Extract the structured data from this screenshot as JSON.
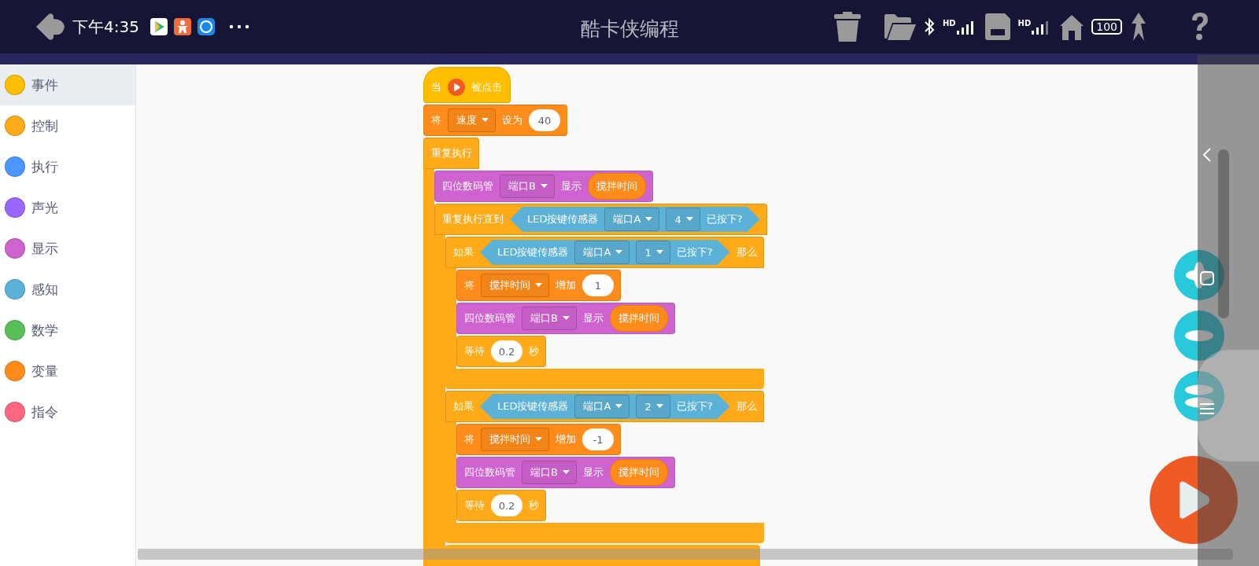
{
  "status_bar": {
    "time": "下午4:35",
    "signal_labels": [
      "HD",
      "HD"
    ],
    "battery": "100"
  },
  "app_bar": {
    "title": "酷卡侠编程"
  },
  "categories": [
    {
      "label": "事件",
      "color": "#ffbf00",
      "selected": true
    },
    {
      "label": "控制",
      "color": "#ffab19",
      "selected": false
    },
    {
      "label": "执行",
      "color": "#4c97ff",
      "selected": false
    },
    {
      "label": "声光",
      "color": "#9966ff",
      "selected": false
    },
    {
      "label": "显示",
      "color": "#cf63cf",
      "selected": false
    },
    {
      "label": "感知",
      "color": "#5cb1d6",
      "selected": false
    },
    {
      "label": "数学",
      "color": "#59c059",
      "selected": false
    },
    {
      "label": "变量",
      "color": "#ff8c1a",
      "selected": false
    },
    {
      "label": "指令",
      "color": "#ff6680",
      "selected": false
    }
  ],
  "script": [
    {
      "kind": "hat",
      "color": "#ffbf00",
      "parts": [
        {
          "kind": "text",
          "text": "当"
        },
        {
          "kind": "flag"
        },
        {
          "kind": "text",
          "text": "被点击"
        }
      ]
    },
    {
      "kind": "stack",
      "color": "#ff8c1a",
      "parts": [
        {
          "kind": "text",
          "text": "将"
        },
        {
          "kind": "dropdown",
          "text": "速度"
        },
        {
          "kind": "text",
          "text": "设为"
        },
        {
          "kind": "number",
          "text": "40"
        }
      ]
    },
    {
      "kind": "c",
      "color": "#ffab19",
      "footer": false,
      "parts": [
        {
          "kind": "text",
          "text": "重复执行"
        }
      ],
      "children": [
        {
          "kind": "stack",
          "color": "#cf63cf",
          "parts": [
            {
              "kind": "text",
              "text": "四位数码管"
            },
            {
              "kind": "dropdown",
              "text": "端口B"
            },
            {
              "kind": "text",
              "text": "显示"
            },
            {
              "kind": "reporter",
              "color": "#ff8c1a",
              "text": "搅拌时间"
            }
          ]
        },
        {
          "kind": "c",
          "color": "#ffab19",
          "footer": false,
          "parts": [
            {
              "kind": "text",
              "text": "重复执行直到"
            },
            {
              "kind": "boolean",
              "color": "#5cb1d6",
              "parts": [
                {
                  "kind": "text",
                  "text": "LED按键传感器"
                },
                {
                  "kind": "dropdown",
                  "text": "端口A"
                },
                {
                  "kind": "dropdown",
                  "text": "4"
                },
                {
                  "kind": "text",
                  "text": "已按下?"
                }
              ]
            }
          ],
          "children": [
            {
              "kind": "c",
              "color": "#ffab19",
              "footer": true,
              "parts": [
                {
                  "kind": "text",
                  "text": "如果"
                },
                {
                  "kind": "boolean",
                  "color": "#5cb1d6",
                  "parts": [
                    {
                      "kind": "text",
                      "text": "LED按键传感器"
                    },
                    {
                      "kind": "dropdown",
                      "text": "端口A"
                    },
                    {
                      "kind": "dropdown",
                      "text": "1"
                    },
                    {
                      "kind": "text",
                      "text": "已按下?"
                    }
                  ]
                },
                {
                  "kind": "text",
                  "text": "那么"
                }
              ],
              "children": [
                {
                  "kind": "stack",
                  "color": "#ff8c1a",
                  "parts": [
                    {
                      "kind": "text",
                      "text": "将"
                    },
                    {
                      "kind": "dropdown",
                      "text": "搅拌时间"
                    },
                    {
                      "kind": "text",
                      "text": "增加"
                    },
                    {
                      "kind": "number",
                      "text": "1"
                    }
                  ]
                },
                {
                  "kind": "stack",
                  "color": "#cf63cf",
                  "parts": [
                    {
                      "kind": "text",
                      "text": "四位数码管"
                    },
                    {
                      "kind": "dropdown",
                      "text": "端口B"
                    },
                    {
                      "kind": "text",
                      "text": "显示"
                    },
                    {
                      "kind": "reporter",
                      "color": "#ff8c1a",
                      "text": "搅拌时间"
                    }
                  ]
                },
                {
                  "kind": "stack",
                  "color": "#ffab19",
                  "parts": [
                    {
                      "kind": "text",
                      "text": "等待"
                    },
                    {
                      "kind": "number",
                      "text": "0.2"
                    },
                    {
                      "kind": "text",
                      "text": "秒"
                    }
                  ]
                }
              ]
            },
            {
              "kind": "c",
              "color": "#ffab19",
              "footer": true,
              "parts": [
                {
                  "kind": "text",
                  "text": "如果"
                },
                {
                  "kind": "boolean",
                  "color": "#5cb1d6",
                  "parts": [
                    {
                      "kind": "text",
                      "text": "LED按键传感器"
                    },
                    {
                      "kind": "dropdown",
                      "text": "端口A"
                    },
                    {
                      "kind": "dropdown",
                      "text": "2"
                    },
                    {
                      "kind": "text",
                      "text": "已按下?"
                    }
                  ]
                },
                {
                  "kind": "text",
                  "text": "那么"
                }
              ],
              "children": [
                {
                  "kind": "stack",
                  "color": "#ff8c1a",
                  "parts": [
                    {
                      "kind": "text",
                      "text": "将"
                    },
                    {
                      "kind": "dropdown",
                      "text": "搅拌时间"
                    },
                    {
                      "kind": "text",
                      "text": "增加"
                    },
                    {
                      "kind": "number",
                      "text": "-1"
                    }
                  ]
                },
                {
                  "kind": "stack",
                  "color": "#cf63cf",
                  "parts": [
                    {
                      "kind": "text",
                      "text": "四位数码管"
                    },
                    {
                      "kind": "dropdown",
                      "text": "端口B"
                    },
                    {
                      "kind": "text",
                      "text": "显示"
                    },
                    {
                      "kind": "reporter",
                      "color": "#ff8c1a",
                      "text": "搅拌时间"
                    }
                  ]
                },
                {
                  "kind": "stack",
                  "color": "#ffab19",
                  "parts": [
                    {
                      "kind": "text",
                      "text": "等待"
                    },
                    {
                      "kind": "number",
                      "text": "0.2"
                    },
                    {
                      "kind": "text",
                      "text": "秒"
                    }
                  ]
                }
              ]
            },
            {
              "kind": "partial",
              "color": "#ffab19"
            }
          ]
        }
      ]
    }
  ]
}
